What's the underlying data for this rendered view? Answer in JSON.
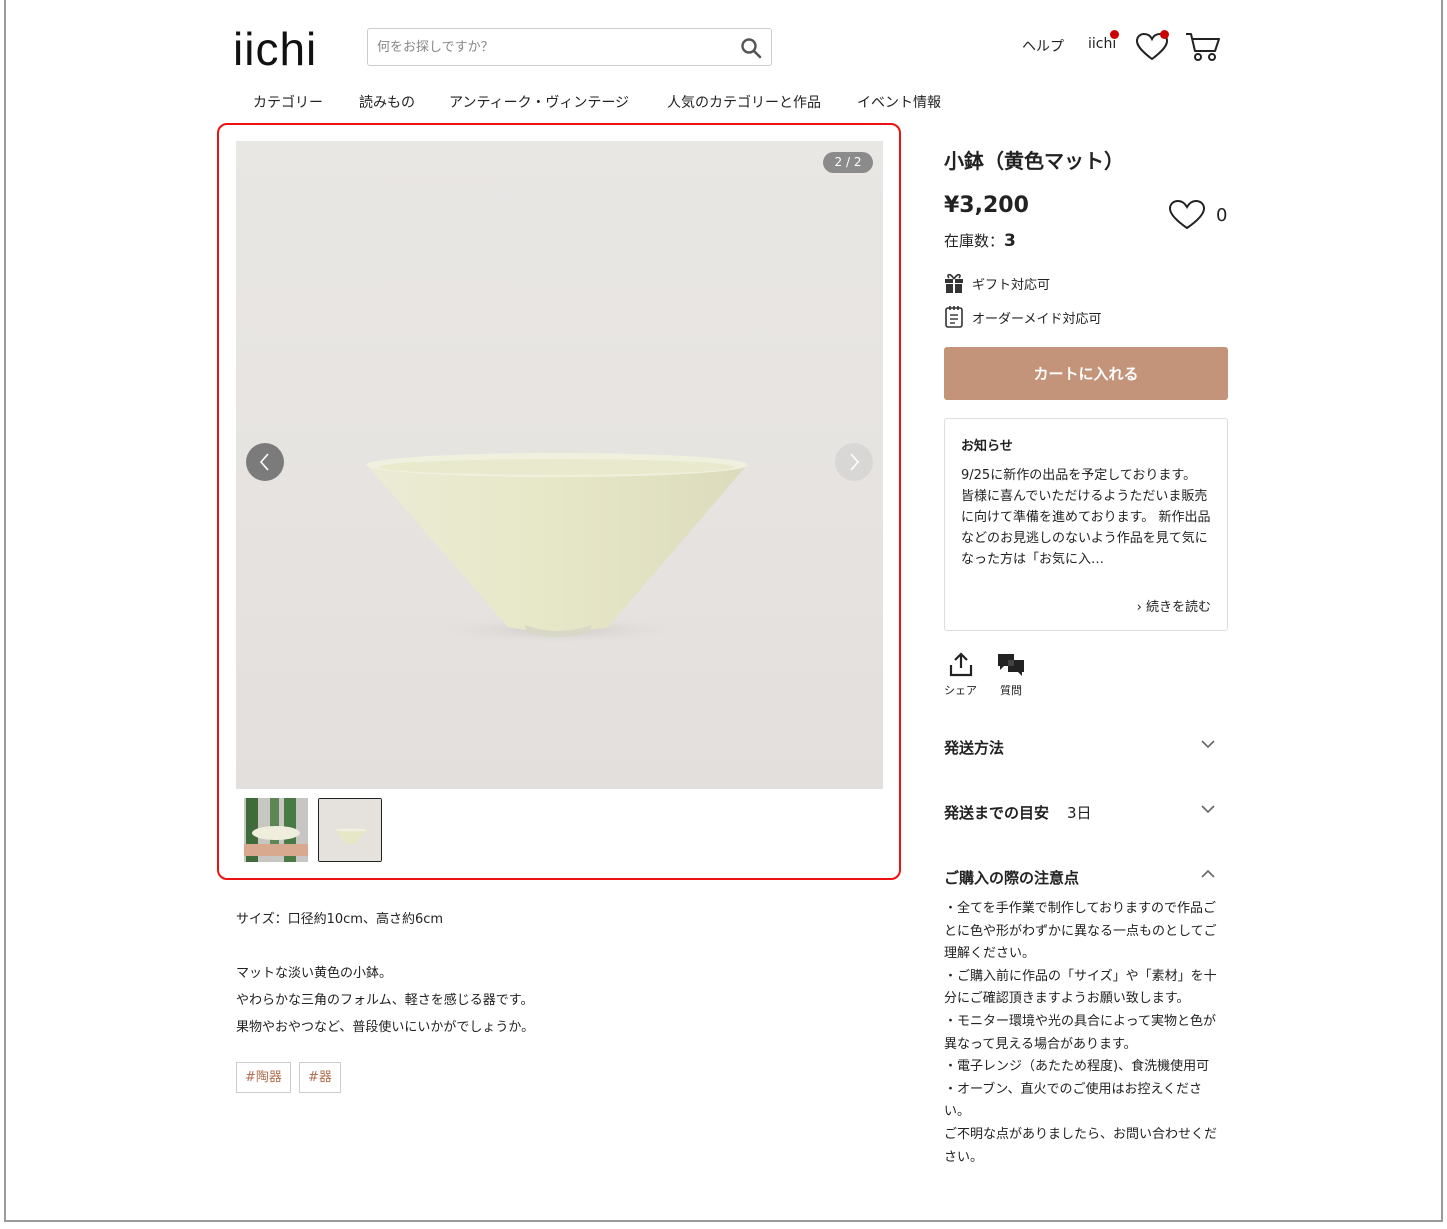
{
  "header": {
    "logo": "iichi",
    "search_placeholder": "何をお探しですか？",
    "help": "ヘルプ",
    "user": "iichi"
  },
  "nav": [
    "カテゴリー",
    "読みもの",
    "アンティーク・ヴィンテージ",
    "人気のカテゴリーと作品",
    "イベント情報"
  ],
  "gallery": {
    "counter": "2 / 2"
  },
  "product": {
    "title": "小鉢（黄色マット）",
    "price": "¥3,200",
    "favorites": "0",
    "stock_label": "在庫数：",
    "stock_value": "3",
    "gift": "ギフト対応可",
    "custom": "オーダーメイド対応可",
    "cart_button": "カートに入れる"
  },
  "notice": {
    "title": "お知らせ",
    "body": "9/25に新作の出品を予定しております。\n皆様に喜んでいただけるようただいま販売に向けて準備を進めております。\n新作出品などのお見逃しのないよう作品を見て気になった方は「お気に入…",
    "read_more": "続きを読む"
  },
  "actions": {
    "share": "シェア",
    "question": "質問"
  },
  "accordions": {
    "shipping": "発送方法",
    "eta_label": "発送までの目安",
    "eta_value": "3日",
    "caution": "ご購入の際の注意点"
  },
  "caution_text": "・全てを手作業で制作しておりますので作品ごとに色や形がわずかに異なる一点ものとしてご理解ください。\n・ご購入前に作品の「サイズ」や「素材」を十分にご確認頂きますようお願い致します。\n・モニター環境や光の具合によって実物と色が異なって見える場合があります。\n・電子レンジ（あたため程度)、食洗機使用可\n・オーブン、直火でのご使用はお控えください。\nご不明な点がありましたら、お問い合わせください。",
  "description": {
    "size": "サイズ：口径約10cm、高さ約6cm",
    "line1": "マットな淡い黄色の小鉢。",
    "line2": "やわらかな三角のフォルム、軽さを感じる器です。",
    "line3": "果物やおやつなど、普段使いにいかがでしょうか。"
  },
  "tags": [
    "#陶器",
    "#器"
  ],
  "colors": {
    "accent": "#c39479",
    "highlight": "#e11111",
    "tag_text": "#b07050"
  }
}
